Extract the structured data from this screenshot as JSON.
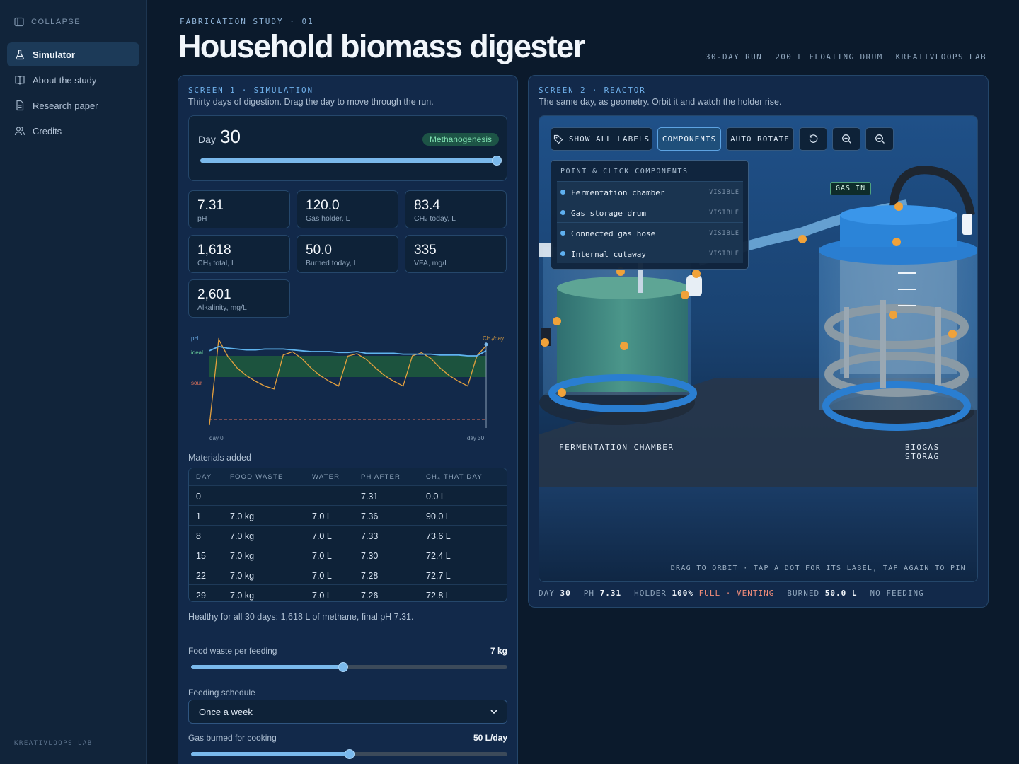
{
  "sidebar": {
    "collapse_label": "COLLAPSE",
    "items": [
      {
        "label": "Simulator",
        "icon": "flask-icon",
        "active": true
      },
      {
        "label": "About the study",
        "icon": "book-icon"
      },
      {
        "label": "Research paper",
        "icon": "document-icon"
      },
      {
        "label": "Credits",
        "icon": "users-icon"
      }
    ],
    "footer": "KREATIVLOOPS LAB"
  },
  "header": {
    "eyebrow": "FABRICATION STUDY · 01",
    "title": "Household biomass digester",
    "meta": [
      "30-DAY RUN",
      "200 L FLOATING DRUM",
      "KREATIVLOOPS LAB"
    ]
  },
  "simulation": {
    "eyebrow": "SCREEN 1 · SIMULATION",
    "subtitle": "Thirty days of digestion. Drag the day to move through the run.",
    "day_label": "Day",
    "day": "30",
    "day_fraction": 1.0,
    "phase": "Methanogenesis",
    "stats": [
      {
        "value": "7.31",
        "label": "pH"
      },
      {
        "value": "120.0",
        "label": "Gas holder, L"
      },
      {
        "value": "83.4",
        "label": "CH₄ today, L"
      },
      {
        "value": "1,618",
        "label": "CH₄ total, L"
      },
      {
        "value": "50.0",
        "label": "Burned today, L"
      },
      {
        "value": "335",
        "label": "VFA, mg/L"
      },
      {
        "value": "2,601",
        "label": "Alkalinity, mg/L"
      }
    ],
    "chart_data": {
      "type": "line",
      "labels": {
        "ph": "pH",
        "ideal": "ideal",
        "sour": "sour",
        "ch4": "CH₄/day",
        "x_start": "day 0",
        "x_end": "day 30"
      },
      "x": [
        0,
        1,
        2,
        3,
        4,
        5,
        6,
        7,
        8,
        9,
        10,
        11,
        12,
        13,
        14,
        15,
        16,
        17,
        18,
        19,
        20,
        21,
        22,
        23,
        24,
        25,
        26,
        27,
        28,
        29,
        30
      ],
      "ph": [
        7.31,
        7.36,
        7.34,
        7.33,
        7.32,
        7.32,
        7.33,
        7.33,
        7.33,
        7.32,
        7.31,
        7.3,
        7.3,
        7.3,
        7.29,
        7.29,
        7.3,
        7.28,
        7.28,
        7.28,
        7.28,
        7.27,
        7.27,
        7.27,
        7.27,
        7.26,
        7.26,
        7.26,
        7.25,
        7.25,
        7.31
      ],
      "ch4": [
        0,
        90,
        72,
        60,
        52,
        46,
        41,
        38,
        73.6,
        77,
        70,
        60,
        52,
        46,
        41,
        72.4,
        75,
        69,
        60,
        52,
        46,
        41,
        72.7,
        76,
        70,
        60,
        52,
        46,
        41,
        72.8,
        83.4
      ],
      "ideal_band_ph": [
        7.0,
        7.25
      ],
      "sour_ph": 6.5
    },
    "materials": {
      "title": "Materials added",
      "headers": [
        "DAY",
        "FOOD WASTE",
        "WATER",
        "PH AFTER",
        "CH₄ THAT DAY"
      ],
      "rows": [
        [
          "0",
          "—",
          "—",
          "7.31",
          "0.0 L"
        ],
        [
          "1",
          "7.0 kg",
          "7.0 L",
          "7.36",
          "90.0 L"
        ],
        [
          "8",
          "7.0 kg",
          "7.0 L",
          "7.33",
          "73.6 L"
        ],
        [
          "15",
          "7.0 kg",
          "7.0 L",
          "7.30",
          "72.4 L"
        ],
        [
          "22",
          "7.0 kg",
          "7.0 L",
          "7.28",
          "72.7 L"
        ],
        [
          "29",
          "7.0 kg",
          "7.0 L",
          "7.26",
          "72.8 L"
        ]
      ]
    },
    "summary": "Healthy for all 30 days: 1,618 L of methane, final pH 7.31.",
    "controls": {
      "food_label": "Food waste per feeding",
      "food_value": "7 kg",
      "food_fraction": 0.48,
      "schedule_label": "Feeding schedule",
      "schedule_value": "Once a week",
      "burn_label": "Gas burned for cooking",
      "burn_value": "50 L/day",
      "burn_fraction": 0.5
    }
  },
  "reactor": {
    "eyebrow": "SCREEN 2 · REACTOR",
    "subtitle": "The same day, as geometry. Orbit it and watch the holder rise.",
    "toolbar": {
      "show_labels": "SHOW ALL LABELS",
      "components": "COMPONENTS",
      "auto_rotate": "AUTO ROTATE"
    },
    "components_panel": {
      "title": "POINT & CLICK COMPONENTS",
      "items": [
        {
          "name": "Fermentation chamber",
          "state": "VISIBLE"
        },
        {
          "name": "Gas storage drum",
          "state": "VISIBLE"
        },
        {
          "name": "Connected gas hose",
          "state": "VISIBLE"
        },
        {
          "name": "Internal cutaway",
          "state": "VISIBLE"
        }
      ]
    },
    "gas_in": "GAS IN",
    "label_chamber": "FERMENTATION CHAMBER",
    "label_storage": "BIOGAS STORAG",
    "hint": "DRAG TO ORBIT · TAP A DOT FOR ITS LABEL, TAP AGAIN TO PIN",
    "status": {
      "day_label": "DAY",
      "day": "30",
      "ph_label": "PH",
      "ph": "7.31",
      "holder_label": "HOLDER",
      "holder": "100%",
      "holder_state": "FULL · VENTING",
      "burned_label": "BURNED",
      "burned": "50.0 L",
      "feeding": "NO FEEDING"
    },
    "colors": {
      "accent": "#6fb0ea",
      "marker": "#f0a23a",
      "chamber": "#3f8a7c",
      "warn": "#f08c7a"
    }
  }
}
